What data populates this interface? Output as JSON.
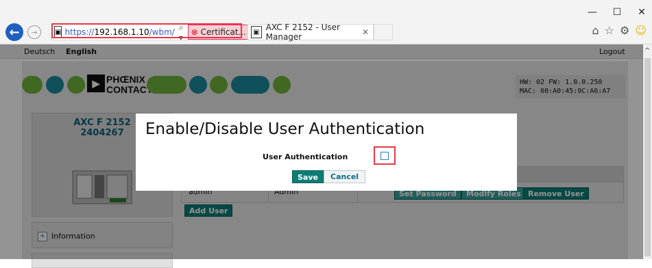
{
  "browser": {
    "url_prefix": "https://",
    "url_host": "192.168.1.10",
    "url_path": "/wbm/",
    "search_glyph": "⌕ ▾",
    "cert_label": "Certificat...",
    "refresh_glyph": "↻",
    "tab_title": "AXC F 2152 - User Manager",
    "window_controls": [
      "—",
      "☐",
      "✕"
    ],
    "toolbar_icons": [
      "home-icon",
      "star-icon",
      "gear-icon",
      "smiley-icon"
    ]
  },
  "langbar": {
    "deutsch": "Deutsch",
    "english": "English",
    "logout": "Logout"
  },
  "header": {
    "logo_line1": "PHŒNIX",
    "logo_line2": "CONTACT",
    "hw_line": "HW: 02 FW: 1.0.0.250",
    "mac_line": "MAC: 00:A0:45:9C:A6:A7"
  },
  "device": {
    "name_line1": "AXC F 2152",
    "name_line2": "2404267"
  },
  "sidebar": {
    "information": "Information"
  },
  "users_table": {
    "row_user": "admin",
    "row_roles": "Admin",
    "set_password": "Set Password",
    "modify_roles": "Modify Roles",
    "remove_user": "Remove User",
    "add_user": "Add User"
  },
  "modal": {
    "title": "Enable/Disable User Authentication",
    "label": "User Authentication",
    "checkbox_checked": false,
    "save": "Save",
    "cancel": "Cancel"
  },
  "colors": {
    "brand_green": "#71b53a",
    "brand_teal": "#1a8a9c",
    "button_teal": "#0c7d75",
    "highlight_red": "#e73746"
  }
}
